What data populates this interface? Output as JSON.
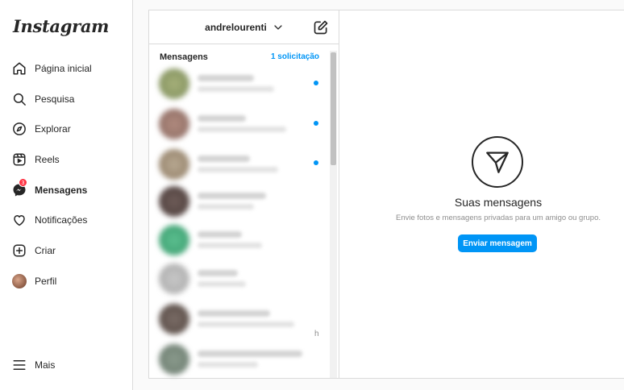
{
  "sidebar": {
    "logo": "Instagram",
    "items": [
      {
        "label": "Página inicial",
        "icon": "home-icon"
      },
      {
        "label": "Pesquisa",
        "icon": "search-icon"
      },
      {
        "label": "Explorar",
        "icon": "compass-icon"
      },
      {
        "label": "Reels",
        "icon": "reels-icon"
      },
      {
        "label": "Mensagens",
        "icon": "messenger-icon",
        "badge": "3"
      },
      {
        "label": "Notificações",
        "icon": "heart-icon"
      },
      {
        "label": "Criar",
        "icon": "plus-square-icon"
      },
      {
        "label": "Perfil",
        "icon": "avatar"
      },
      {
        "label": "Mais",
        "icon": "menu-icon"
      }
    ]
  },
  "inbox": {
    "username": "andrelourenti",
    "section_title": "Mensagens",
    "requests_link": "1 solicitação",
    "hint_char": "h"
  },
  "empty_state": {
    "title": "Suas mensagens",
    "subtitle": "Envie fotos e mensagens privadas para um amigo ou grupo.",
    "button": "Enviar mensagem"
  },
  "colors": {
    "accent": "#0095f6",
    "badge": "#ff3040"
  }
}
